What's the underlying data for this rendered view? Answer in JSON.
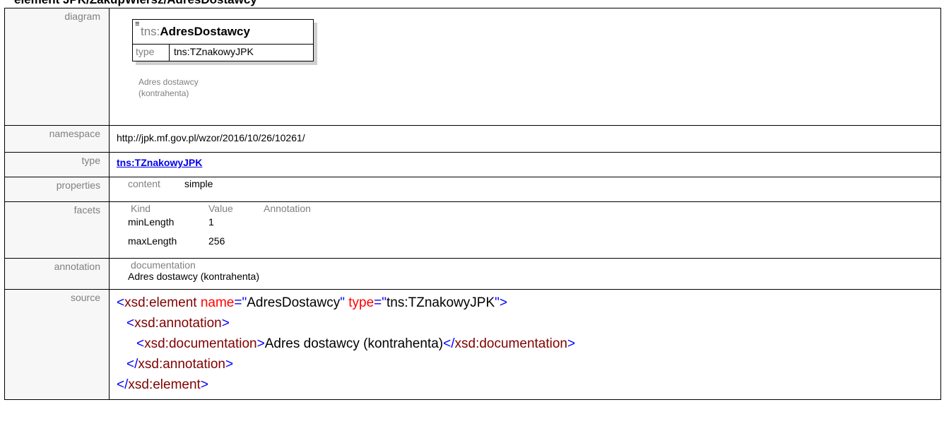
{
  "header_title": "element JPK/ZakupWiersz/AdresDostawcy",
  "labels": {
    "diagram": "diagram",
    "namespace": "namespace",
    "type": "type",
    "properties": "properties",
    "facets": "facets",
    "annotation": "annotation",
    "source": "source"
  },
  "diagram": {
    "prefix": "tns:",
    "name": "AdresDostawcy",
    "type_label": "type",
    "type_value": "tns:TZnakowyJPK",
    "note_line1": "Adres dostawcy",
    "note_line2": "(kontrahenta)",
    "doc_icon": "documentation-icon"
  },
  "namespace": "http://jpk.mf.gov.pl/wzor/2016/10/26/10261/",
  "type_link": "tns:TZnakowyJPK",
  "properties": {
    "key": "content",
    "value": "simple"
  },
  "facets": {
    "headers": [
      "Kind",
      "Value",
      "Annotation"
    ],
    "rows": [
      {
        "kind": "minLength",
        "value": "1"
      },
      {
        "kind": "maxLength",
        "value": "256"
      }
    ]
  },
  "annotation": {
    "key": "documentation",
    "value": "Adres dostawcy (kontrahenta)"
  },
  "source": {
    "l1_open": "<",
    "l1_tag": "xsd:element",
    "l1_attr1": " name",
    "l1_eq1": "=\"",
    "l1_val1": "AdresDostawcy",
    "l1_q1": "\"",
    "l1_attr2": " type",
    "l1_eq2": "=\"",
    "l1_val2": "tns:TZnakowyJPK",
    "l1_close": "\">",
    "l2_open": "<",
    "l2_tag": "xsd:annotation",
    "l2_close": ">",
    "l3_open": "<",
    "l3_tag": "xsd:documentation",
    "l3_gt": ">",
    "l3_text": "Adres dostawcy (kontrahenta)",
    "l3_endopen": "</",
    "l3_endtag": "xsd:documentation",
    "l3_endclose": ">",
    "l4_open": "</",
    "l4_tag": "xsd:annotation",
    "l4_close": ">",
    "l5_open": "</",
    "l5_tag": "xsd:element",
    "l5_close": ">"
  },
  "colors": {
    "markup_blue": "#0000ff",
    "tag_maroon": "#800000",
    "attr_red": "#ff0000",
    "label_gray": "#808080",
    "link_blue": "#0000ee"
  }
}
